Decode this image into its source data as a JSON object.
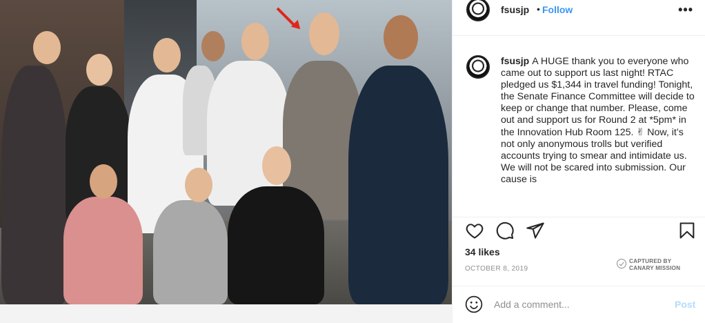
{
  "post": {
    "username": "fsusjp",
    "follow_label": "Follow",
    "dot": "•",
    "more_label": "•••",
    "caption": "A HUGE thank you to everyone who came out to support us last night! RTAC pledged us $1,344 in travel funding! Tonight, the Senate Finance Committee will decide to keep or change that number. Please, come out and support us for Round 2 at *5pm* in the Innovation Hub Room 125. ✌ Now, it’s not only anonymous trolls but verified accounts trying to smear and intimidate us. We will not be scared into submission. Our cause is",
    "likes": "34 likes",
    "date": "OCTOBER 8, 2019"
  },
  "watermark": {
    "line1": "CAPTURED BY",
    "line2": "CANARY MISSION"
  },
  "comment": {
    "placeholder": "Add a comment...",
    "post_label": "Post"
  },
  "icons": {
    "like": "heart-icon",
    "comment": "comment-bubble-icon",
    "share": "paper-plane-icon",
    "save": "bookmark-icon",
    "emoji": "smiley-icon",
    "more": "more-options-icon"
  },
  "colors": {
    "follow": "#3897f0",
    "post_disabled": "#b3dbff",
    "secondary_text": "#8e8e8e",
    "annotation_arrow": "#e0261c"
  }
}
